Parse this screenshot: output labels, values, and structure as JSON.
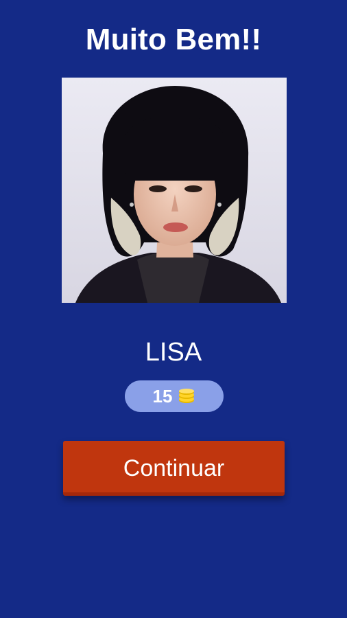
{
  "header": {
    "title": "Muito Bem!!"
  },
  "result": {
    "answer": "LISA"
  },
  "reward": {
    "coins": "15",
    "icon": "coin-stack-icon"
  },
  "actions": {
    "continue_label": "Continuar"
  },
  "colors": {
    "background": "#142a87",
    "button": "#c0360e",
    "pill": "#8aa0e8",
    "coin": "#ffd42a"
  }
}
